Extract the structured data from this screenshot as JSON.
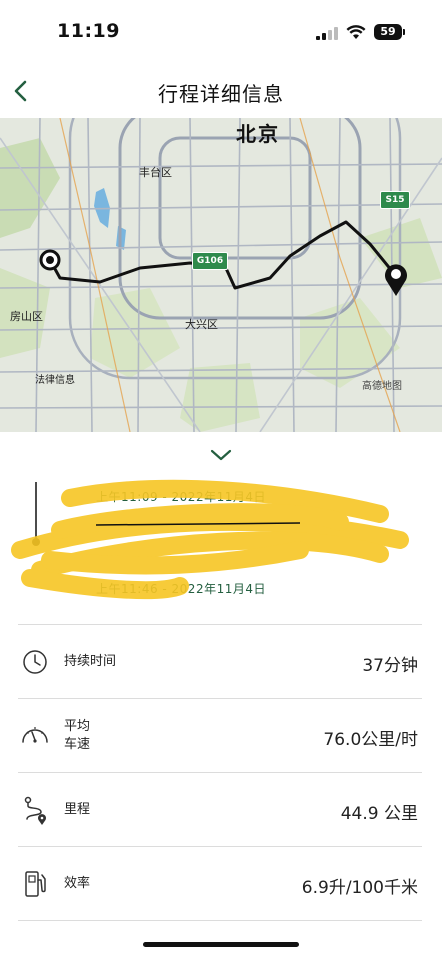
{
  "status": {
    "time": "11:19",
    "battery": "59"
  },
  "nav": {
    "title": "行程详细信息"
  },
  "map": {
    "labels": {
      "beijing": "北京",
      "fengtai": "丰台区",
      "fangshan": "房山区",
      "daxing": "大兴区",
      "g106": "G106",
      "s15": "S15",
      "legal": "法律信息",
      "provider": "高德地图"
    }
  },
  "trip": {
    "start": "上午11:09 - 2022年11月4日",
    "end": "上午11:46 - 2022年11月4日"
  },
  "stats": [
    {
      "label": "持续时间",
      "value": "37分钟"
    },
    {
      "label": "平均\n车速",
      "value": "76.0公里/时"
    },
    {
      "label": "里程",
      "value": "44.9 公里"
    },
    {
      "label": "效率",
      "value": "6.9升/100千米"
    }
  ],
  "colors": {
    "accent": "#245f40",
    "route": "#111111",
    "scribble": "#f7c624"
  }
}
